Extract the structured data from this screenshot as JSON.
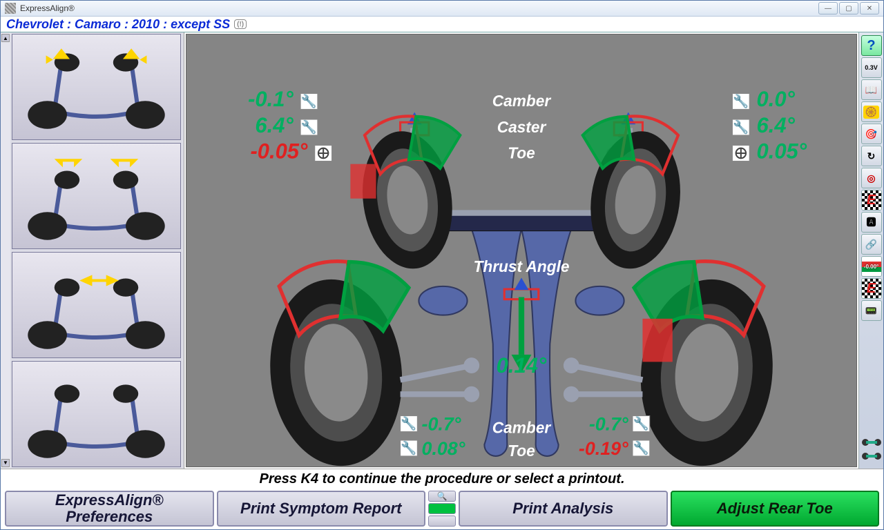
{
  "titlebar": {
    "app_title": "ExpressAlign®"
  },
  "vehicle": "Chevrolet : Camaro : 2010 : except SS",
  "front": {
    "labels": {
      "camber": "Camber",
      "caster": "Caster",
      "toe": "Toe"
    },
    "left": {
      "camber": "-0.1°",
      "caster": "6.4°",
      "toe": "-0.05°"
    },
    "right": {
      "camber": "0.0°",
      "caster": "6.4°",
      "toe": "0.05°"
    },
    "left_status": {
      "camber": "green",
      "caster": "green",
      "toe": "red"
    },
    "right_status": {
      "camber": "green",
      "caster": "green",
      "toe": "green"
    }
  },
  "thrust": {
    "label": "Thrust Angle",
    "value": "0.14°",
    "status": "green"
  },
  "rear": {
    "labels": {
      "camber": "Camber",
      "toe": "Toe"
    },
    "left": {
      "camber": "-0.7°",
      "toe": "0.08°"
    },
    "right": {
      "camber": "-0.7°",
      "toe": "-0.19°"
    },
    "left_status": {
      "camber": "green",
      "toe": "green"
    },
    "right_status": {
      "camber": "green",
      "toe": "red"
    }
  },
  "status_line": "Press K4 to continue the procedure or select a printout.",
  "buttons": {
    "b1": "ExpressAlign® Preferences",
    "b2": "Print Symptom Report",
    "b3": "Print Analysis",
    "b4": "Adjust Rear Toe"
  },
  "right_tools": [
    "help-icon",
    "voltage-icon",
    "book-icon",
    "tire-icon",
    "steering-lock-icon",
    "refresh-icon",
    "target-icon",
    "express-e-icon",
    "caster-sweep-icon",
    "data-link-icon",
    "tolerance-stripe-icon",
    "express-e2-icon",
    "pager-icon"
  ],
  "thumb_modes": [
    "toe-mode",
    "caster-mode",
    "thrust-mode",
    "overview-mode"
  ]
}
